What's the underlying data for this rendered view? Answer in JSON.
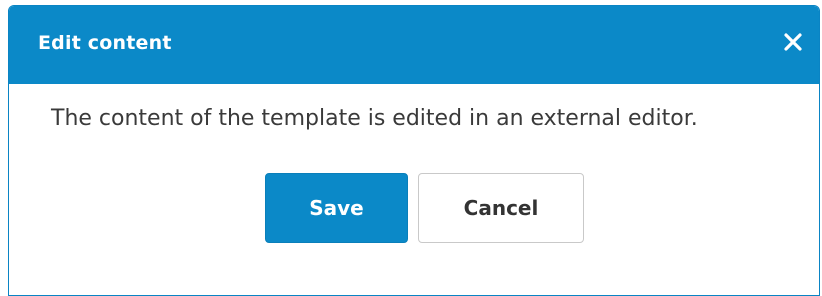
{
  "dialog": {
    "title": "Edit content",
    "close_icon": "close-icon",
    "message": "The content of the template is edited in an external editor.",
    "save_label": "Save",
    "cancel_label": "Cancel"
  },
  "colors": {
    "header": "#0b89c8",
    "primary_button": "#0b89c8",
    "text": "#3a3a3a"
  }
}
